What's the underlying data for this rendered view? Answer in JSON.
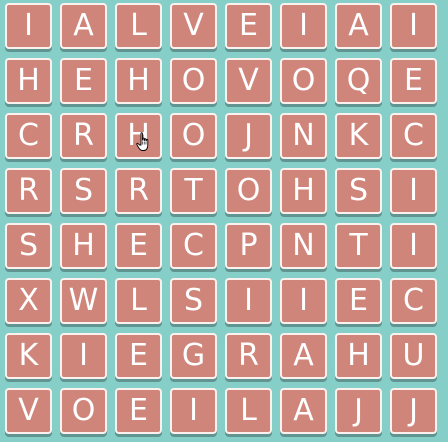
{
  "grid": {
    "rows": [
      [
        "I",
        "A",
        "L",
        "V",
        "E",
        "I",
        "A",
        "I"
      ],
      [
        "H",
        "E",
        "H",
        "O",
        "V",
        "O",
        "Q",
        "E"
      ],
      [
        "C",
        "R",
        "H",
        "O",
        "J",
        "N",
        "K",
        "C"
      ],
      [
        "R",
        "S",
        "R",
        "T",
        "O",
        "H",
        "S",
        "I"
      ],
      [
        "S",
        "H",
        "E",
        "C",
        "P",
        "N",
        "T",
        "I"
      ],
      [
        "X",
        "W",
        "L",
        "S",
        "I",
        "I",
        "E",
        "C"
      ],
      [
        "K",
        "I",
        "E",
        "G",
        "R",
        "A",
        "H",
        "U"
      ],
      [
        "V",
        "O",
        "E",
        "I",
        "L",
        "A",
        "J",
        "J"
      ]
    ]
  },
  "colors": {
    "background": "#86cfc9",
    "tile": "#cf857a",
    "tile_border": "#fbf1ee",
    "letter": "#ffffff"
  },
  "cursor": {
    "icon": "hand-pointer-icon"
  }
}
